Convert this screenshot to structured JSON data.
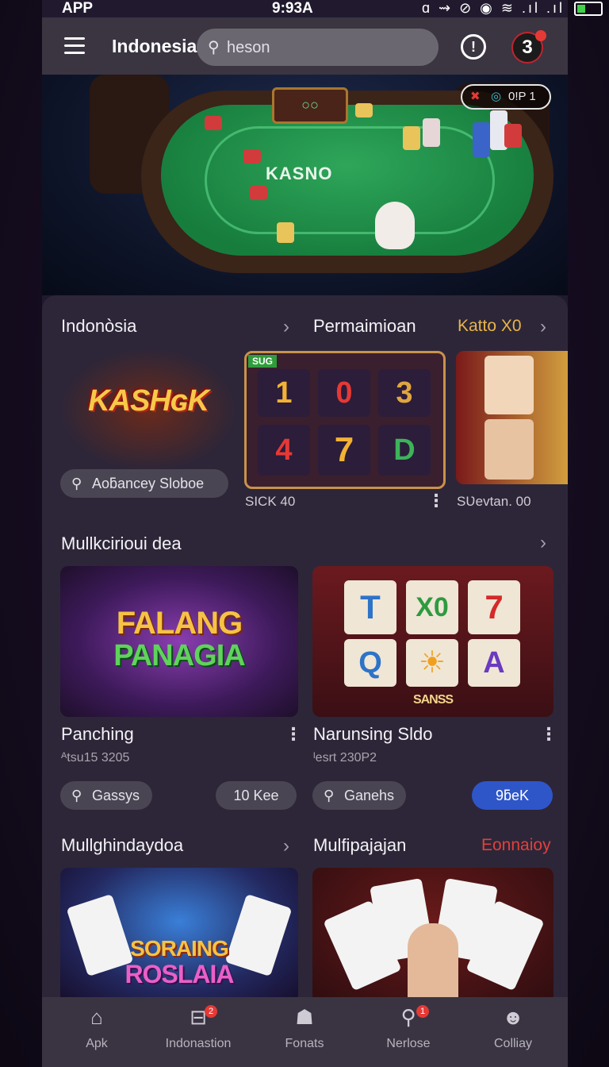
{
  "status_bar": {
    "app": "APP",
    "time": "9:93A",
    "icons": "ɑ ⇝ ⊘ ◉ ≋ .ıl .ıl"
  },
  "top_bar": {
    "region": "Indonesia",
    "search_placeholder": "heson"
  },
  "avatar": {
    "label": "3"
  },
  "hero": {
    "table_brand": "KASNO",
    "badge_x": "✖",
    "badge_text": "0!P 1",
    "score_text": "○○"
  },
  "section1": {
    "title": "Indonòsia",
    "title2": "Permaimioan",
    "accent": "Katto X0",
    "card1": {
      "title": "KASHɢK",
      "pill": "Aoƃancey Sloboe"
    },
    "card2": {
      "badge": "SUG",
      "reels": [
        "1",
        "0",
        "3",
        "4",
        "7",
        "D"
      ],
      "label": "SICK 40"
    },
    "card3": {
      "label": "SƲevtan. 00"
    }
  },
  "section2": {
    "title": "Mullkcirioui dea",
    "games": [
      {
        "thumb_line1": "FALANG",
        "thumb_line2": "PANAGIA",
        "title": "Panching",
        "sub": "ᴬtsu15 3205",
        "pill_left": "Gassys",
        "pill_right": "10 Kee"
      },
      {
        "thumb_caption": "SANSS",
        "reels": [
          "T",
          "X0",
          "7",
          "Q",
          "☀",
          "A"
        ],
        "title": "Narunsing Sldo",
        "sub": "ᴵesrt 230P2",
        "pill_left": "Ganehs",
        "pill_right": "9ƃeK"
      }
    ]
  },
  "section3": {
    "title": "Mullghindaydoa",
    "title2": "Mulfipajajan",
    "accent": "Eonnaioy",
    "thumb1_line1": "SORAING",
    "thumb1_line2": "ROSLAIA"
  },
  "nav": [
    {
      "label": "Apk",
      "icon": "⌂"
    },
    {
      "label": "Indonastion",
      "icon": "⊟",
      "badge": "2"
    },
    {
      "label": "Fonats",
      "icon": "☗"
    },
    {
      "label": "Nerlose",
      "icon": "⚲",
      "badge": "1"
    },
    {
      "label": "Colliay",
      "icon": "☻"
    }
  ],
  "colors": {
    "accent_gold": "#e7b54a",
    "accent_red": "#e0413c",
    "primary_blue": "#2f56c9"
  }
}
